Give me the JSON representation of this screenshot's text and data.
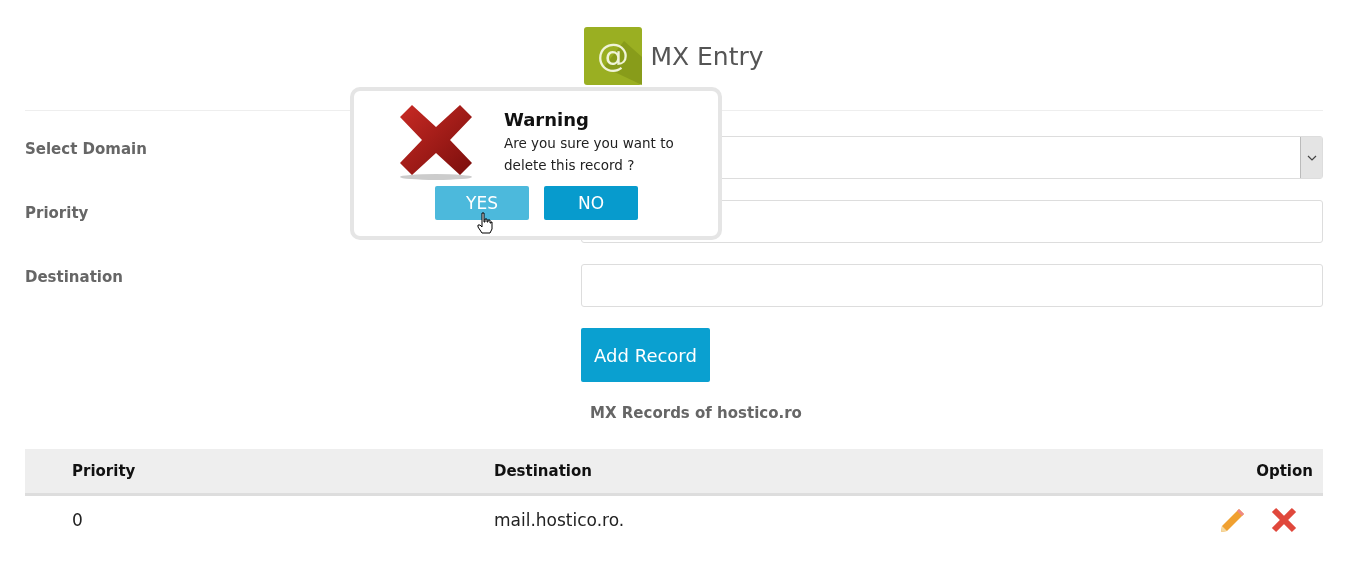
{
  "header": {
    "icon_text": "@",
    "title": "MX Entry"
  },
  "form": {
    "fields": [
      {
        "label": "Select Domain",
        "kind": "select"
      },
      {
        "label": "Priority",
        "kind": "text"
      },
      {
        "label": "Destination",
        "kind": "text"
      }
    ],
    "submit": "Add Record"
  },
  "records_title": "MX Records of hostico.ro",
  "table": {
    "columns": [
      "Priority",
      "Destination",
      "Option"
    ],
    "rows": [
      {
        "cells": [
          "0",
          "mail.hostico.ro."
        ]
      }
    ]
  },
  "dialog": {
    "title": "Warning",
    "message": "Are you sure you want to delete this record ?",
    "buttons": [
      {
        "label": "YES",
        "hovered": true
      },
      {
        "label": "NO",
        "hovered": false
      }
    ]
  }
}
